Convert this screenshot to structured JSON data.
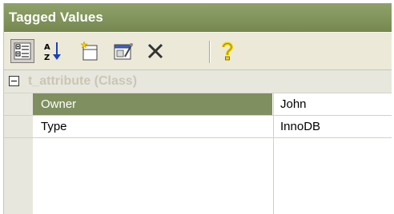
{
  "panel": {
    "title": "Tagged Values"
  },
  "toolbar": {
    "buttons": [
      {
        "name": "categorized-view-icon",
        "active": true
      },
      {
        "name": "sort-alphabetical-icon",
        "active": false
      },
      {
        "name": "new-tag-icon",
        "active": false
      },
      {
        "name": "edit-properties-icon",
        "active": false
      },
      {
        "name": "delete-icon",
        "active": false
      },
      {
        "name": "help-icon",
        "active": false
      }
    ]
  },
  "grid": {
    "group": {
      "label": "t_attribute (Class)",
      "expanded": true
    },
    "rows": [
      {
        "name": "Owner",
        "value": "John",
        "selected": true
      },
      {
        "name": "Type",
        "value": "InnoDB",
        "selected": false
      }
    ]
  },
  "colors": {
    "title_bar": "#7f915b",
    "selection": "#7f8f5f",
    "toolbar_bg": "#ece9d8"
  }
}
